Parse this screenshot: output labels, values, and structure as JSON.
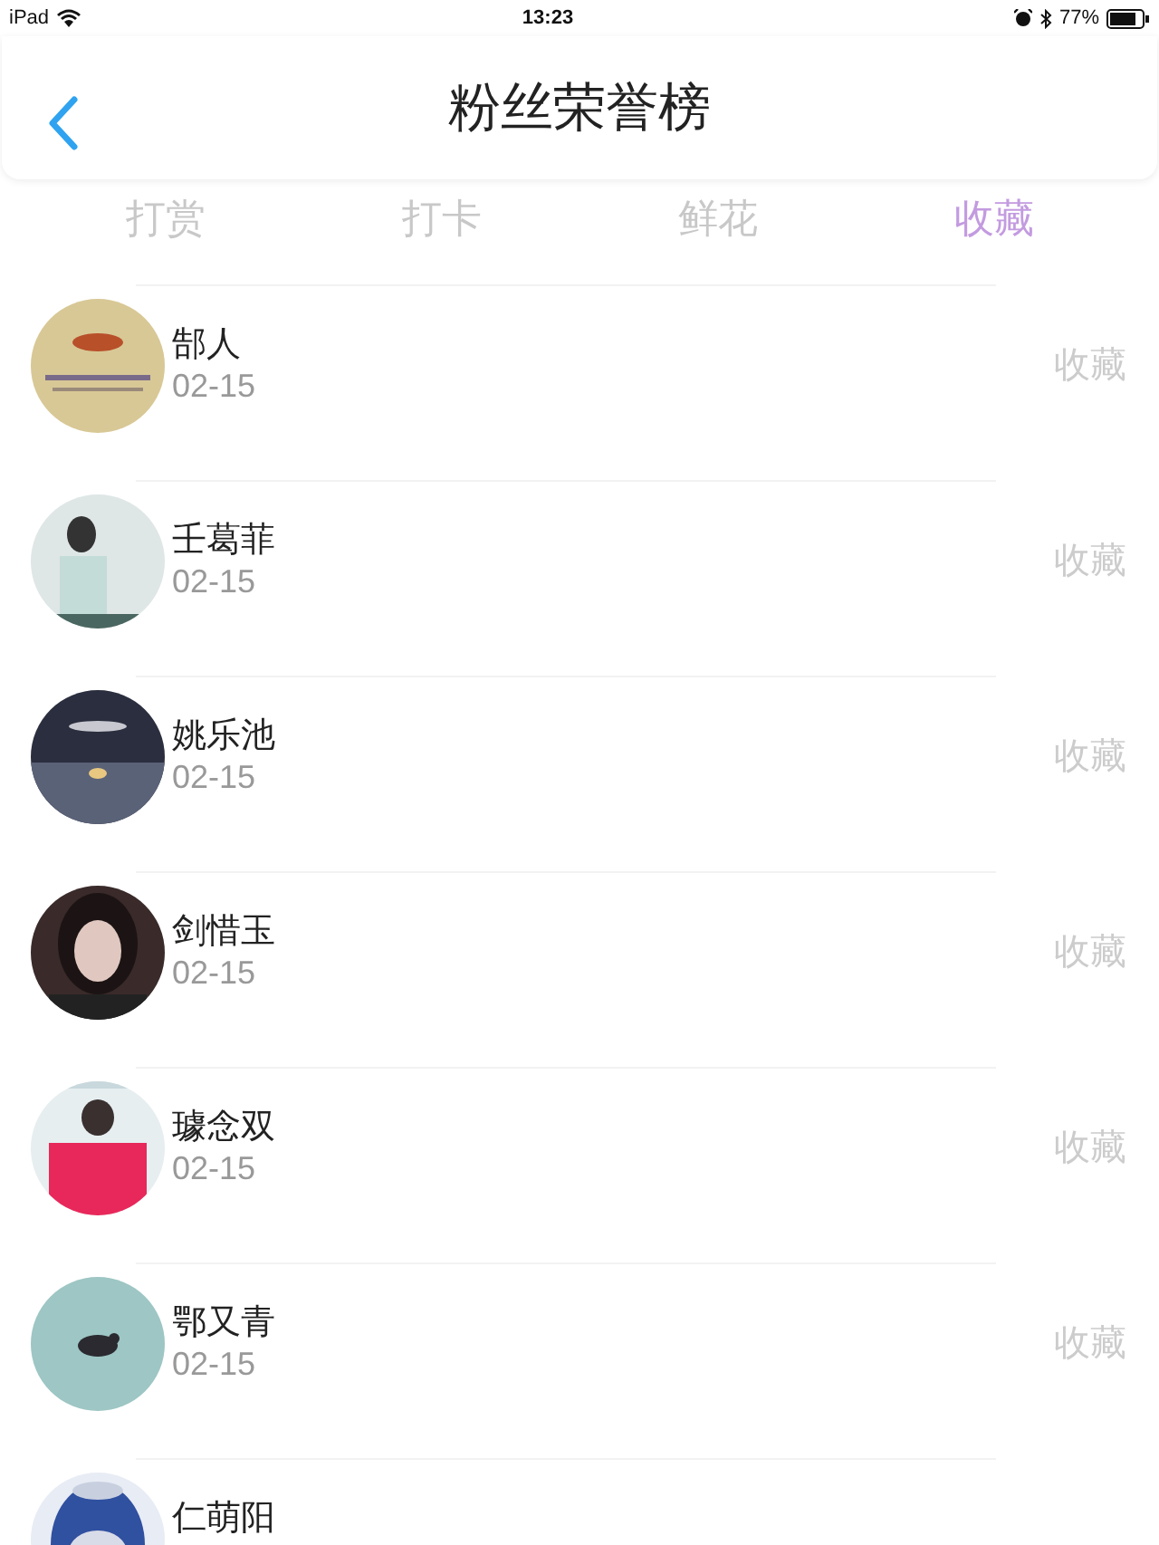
{
  "status_bar": {
    "device": "iPad",
    "time": "13:23",
    "battery": "77%"
  },
  "header": {
    "title": "粉丝荣誉榜"
  },
  "tabs": [
    {
      "label": "打赏",
      "selected": false
    },
    {
      "label": "打卡",
      "selected": false
    },
    {
      "label": "鲜花",
      "selected": false
    },
    {
      "label": "收藏",
      "selected": true
    }
  ],
  "fans": [
    {
      "name": "郜人",
      "date": "02-15",
      "action": "收藏"
    },
    {
      "name": "壬葛菲",
      "date": "02-15",
      "action": "收藏"
    },
    {
      "name": "姚乐池",
      "date": "02-15",
      "action": "收藏"
    },
    {
      "name": "剑惜玉",
      "date": "02-15",
      "action": "收藏"
    },
    {
      "name": "璩念双",
      "date": "02-15",
      "action": "收藏"
    },
    {
      "name": "鄂又青",
      "date": "02-15",
      "action": "收藏"
    },
    {
      "name": "仁萌阳"
    }
  ]
}
